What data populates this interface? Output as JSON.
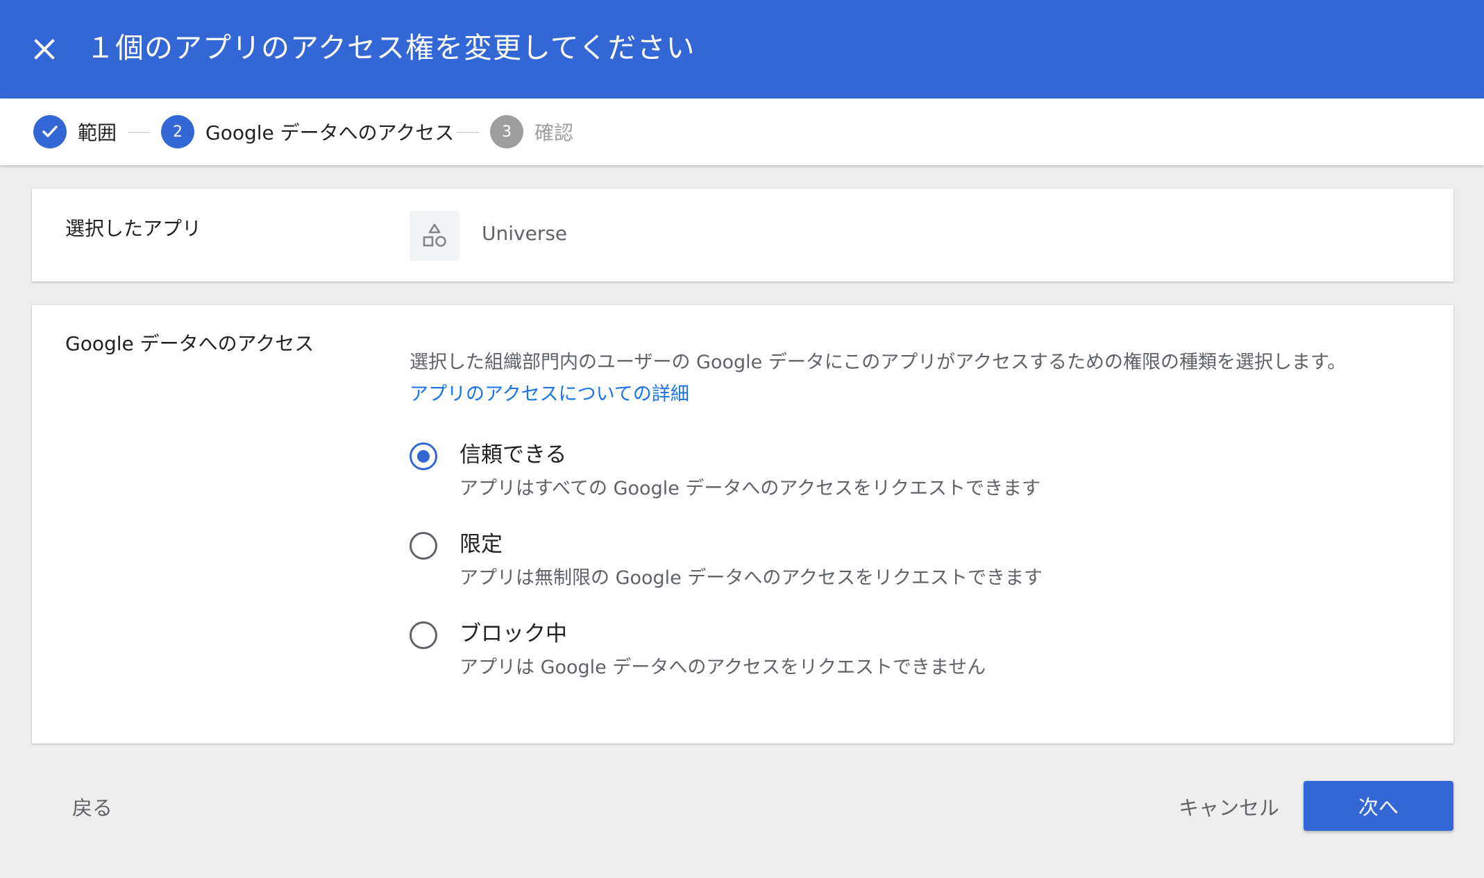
{
  "header": {
    "title": "１個のアプリのアクセス権を変更してください",
    "close_icon": "close-icon"
  },
  "stepper": {
    "steps": [
      {
        "number": "1",
        "label": "範囲",
        "state": "completed",
        "icon": "check-icon"
      },
      {
        "number": "2",
        "label": "Google データへのアクセス",
        "state": "active"
      },
      {
        "number": "3",
        "label": "確認",
        "state": "upcoming"
      }
    ]
  },
  "selected_app": {
    "label": "選択したアプリ",
    "app_name": "Universe",
    "app_icon": "app-shapes-icon"
  },
  "access": {
    "label": "Google データへのアクセス",
    "description": "選択した組織部門内のユーザーの Google データにこのアプリがアクセスするための権限の種類を選択します。",
    "link": "アプリのアクセスについての詳細",
    "options": [
      {
        "title": "信頼できる",
        "description": "アプリはすべての Google データへのアクセスをリクエストできます",
        "selected": true
      },
      {
        "title": "限定",
        "description": "アプリは無制限の Google データへのアクセスをリクエストできます",
        "selected": false
      },
      {
        "title": "ブロック中",
        "description": "アプリは Google データへのアクセスをリクエストできません",
        "selected": false
      }
    ]
  },
  "footer": {
    "back_label": "戻る",
    "cancel_label": "キャンセル",
    "next_label": "次へ"
  },
  "colors": {
    "primary": "#3367d6",
    "link": "#1a73e8",
    "inactive_step": "#9e9e9e",
    "background": "#eeeeee"
  }
}
